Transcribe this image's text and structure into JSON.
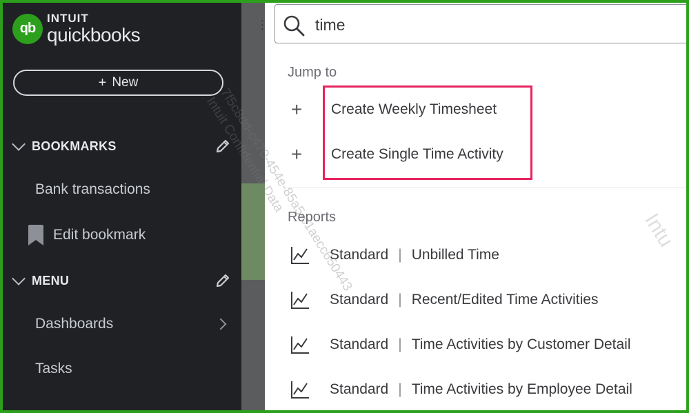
{
  "app": {
    "brand_top": "INTUIT",
    "brand_name": "quickbooks",
    "logo_badge": "qb",
    "brand_color": "#2ca01c"
  },
  "sidebar": {
    "new_button": {
      "icon": "plus-icon",
      "label": "New"
    },
    "bookmarks": {
      "title": "BOOKMARKS",
      "items": [
        "Bank transactions"
      ],
      "edit_bookmark": "Edit bookmark"
    },
    "menu": {
      "title": "MENU",
      "items": [
        "Dashboards",
        "Tasks"
      ]
    }
  },
  "search": {
    "value": "time",
    "jump_to": {
      "title": "Jump to",
      "items": [
        "Create Weekly Timesheet",
        "Create Single Time Activity"
      ]
    },
    "reports": {
      "title": "Reports",
      "items": [
        {
          "type": "Standard",
          "separator": "|",
          "name": "Unbilled Time"
        },
        {
          "type": "Standard",
          "separator": "|",
          "name": "Recent/Edited Time Activities"
        },
        {
          "type": "Standard",
          "separator": "|",
          "name": "Time Activities by Customer Detail"
        },
        {
          "type": "Standard",
          "separator": "|",
          "name": "Time Activities by Employee Detail"
        }
      ]
    }
  },
  "overlay": {
    "highlight_color": "#e8245e",
    "watermark_line1": "7f5c8dd-c470-454e-85a5-c1aecc650443",
    "watermark_line2": "Intuit Confidential Data",
    "watermark_right": "Intu"
  }
}
